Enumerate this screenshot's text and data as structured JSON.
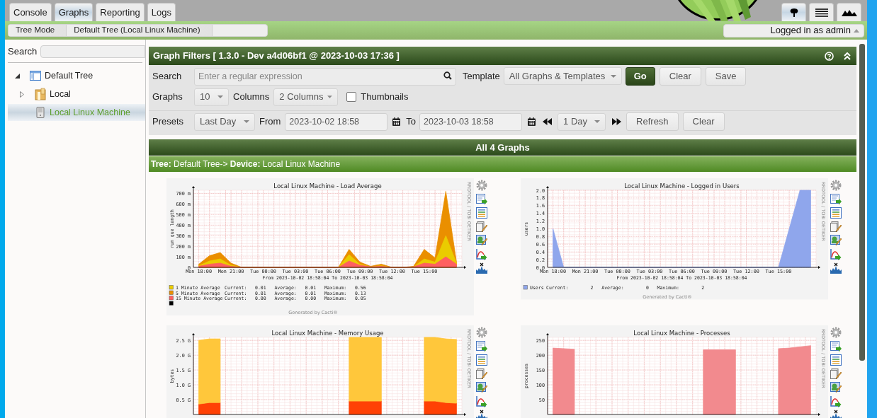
{
  "tabs": [
    {
      "label": "Console",
      "selected": false
    },
    {
      "label": "Graphs",
      "selected": true
    },
    {
      "label": "Reporting",
      "selected": false
    },
    {
      "label": "Logs",
      "selected": false
    }
  ],
  "view_buttons": [
    {
      "kind": "tree",
      "selected": true
    },
    {
      "kind": "list",
      "selected": false
    },
    {
      "kind": "preview",
      "selected": false
    }
  ],
  "breadcrumbs": [
    "Tree Mode",
    "Default Tree (Local Linux Machine)"
  ],
  "user_menu": {
    "label": "Logged in as admin"
  },
  "sidebar": {
    "search_label": "Search",
    "tree": [
      {
        "label": "Default Tree",
        "kind": "tree",
        "expanded": true,
        "selected": false,
        "children": [
          {
            "label": "Local",
            "kind": "site",
            "expanded": false,
            "selected": false
          },
          {
            "label": "Local Linux Machine",
            "kind": "device",
            "selected": true
          }
        ]
      }
    ]
  },
  "filters": {
    "title": "Graph Filters [ 1.3.0 - Dev a4d06bf1 @ 2023-10-03 17:36 ]",
    "search": {
      "label": "Search",
      "placeholder": "Enter a regular expression"
    },
    "template": {
      "label": "Template",
      "value": "All Graphs & Templates"
    },
    "buttons": [
      {
        "label": "Go",
        "kind": "primary"
      },
      {
        "label": "Clear",
        "kind": "normal"
      },
      {
        "label": "Save",
        "kind": "normal"
      }
    ],
    "graphs": {
      "label": "Graphs",
      "value": "10"
    },
    "columns": {
      "label": "Columns",
      "value": "2 Columns"
    },
    "thumbnails": {
      "label": "Thumbnails",
      "checked": false
    },
    "presets": {
      "label": "Presets",
      "value": "Last Day"
    },
    "from": {
      "label": "From",
      "value": "2023-10-02 18:58"
    },
    "to": {
      "label": "To",
      "value": "2023-10-03 18:58"
    },
    "timespan": {
      "value": "1 Day"
    },
    "time_buttons": [
      "Refresh",
      "Clear"
    ]
  },
  "graphs_header": "All 4 Graphs",
  "tree_path": "**Tree:** Default Tree-> **Device:** Local Linux Machine",
  "graphs": [
    {
      "side_text": "RRDTOOL / TOBI OETIKER",
      "range": "From 2023-10-02 18:58:04 To 2023-10-03 18:58:04",
      "credit": "Generated by Cacti®",
      "legend": [
        {
          "color": "#EACC00",
          "label": "1 Minute Average",
          "stats": "Current:   0.01   Average:   0.01   Maximum:   0.56"
        },
        {
          "color": "#EA8F00",
          "label": "5 Minute Average",
          "stats": "Current:   0.01   Average:   0.01   Maximum:   0.13"
        },
        {
          "color": "#FF6060",
          "label": "15 Minute Average",
          "stats": "Current:   0.00   Average:   0.00   Maximum:   0.05"
        },
        {
          "color": "#000000"
        }
      ],
      "chart_data": {
        "type": "area",
        "grid": true,
        "title": "Local Linux Machine - Load Average",
        "ylabel": "run que length",
        "categories": [
          "Mon 18:00",
          null,
          null,
          "Mon 21:00",
          null,
          null,
          "Tue 00:00",
          null,
          null,
          "Tue 03:00",
          null,
          null,
          "Tue 06:00",
          null,
          null,
          "Tue 09:00",
          null,
          null,
          "Tue 12:00",
          null,
          null,
          "Tue 15:00",
          null,
          null,
          null
        ],
        "series": [
          {
            "color": "#EA8F00",
            "values": [
              30,
              110,
              140,
              40,
              0,
              0,
              0,
              0,
              0,
              0,
              0,
              0,
              0,
              0,
              170,
              50,
              10,
              30,
              0,
              0,
              10,
              170,
              90,
              720,
              50
            ]
          },
          {
            "color": "#EACC00",
            "values": [
              15,
              60,
              80,
              20,
              0,
              0,
              0,
              0,
              0,
              0,
              0,
              0,
              0,
              0,
              120,
              30,
              5,
              15,
              0,
              0,
              5,
              80,
              50,
              300,
              40
            ]
          },
          {
            "color": "#FF6060",
            "values": [
              10,
              30,
              40,
              10,
              0,
              0,
              0,
              0,
              0,
              0,
              0,
              0,
              0,
              0,
              60,
              20,
              5,
              10,
              0,
              0,
              5,
              40,
              30,
              100,
              30
            ]
          }
        ],
        "ylim": [
          0,
          730
        ],
        "yticks": [
          {
            "value": 0,
            "label": "0"
          },
          {
            "value": 100,
            "label": "100 m"
          },
          {
            "value": 200,
            "label": "200 m"
          },
          {
            "value": 300,
            "label": "300 m"
          },
          {
            "value": 400,
            "label": "400 m"
          },
          {
            "value": 500,
            "label": "500 m"
          },
          {
            "value": 600,
            "label": "600 m"
          },
          {
            "value": 700,
            "label": "700 m"
          }
        ]
      }
    },
    {
      "side_text": "RRDTOOL / TOBI OETIKER",
      "range": "From 2023-10-02 18:58:04 To 2023-10-03 18:58:04",
      "credit": "Generated by Cacti®",
      "legend": [
        {
          "color": "#8FA6EC",
          "label": "Users",
          "stats": "Current:        2   Average:        0   Maximum:        2"
        }
      ],
      "chart_data": {
        "type": "area",
        "grid": true,
        "title": "Local Linux Machine - Logged in Users",
        "ylabel": "users",
        "categories": [
          "Mon 18:00",
          null,
          null,
          "Mon 21:00",
          null,
          null,
          "Tue 00:00",
          null,
          null,
          "Tue 03:00",
          null,
          null,
          "Tue 06:00",
          null,
          null,
          "Tue 09:00",
          null,
          null,
          "Tue 12:00",
          null,
          null,
          "Tue 15:00",
          null,
          null,
          null
        ],
        "series": [
          {
            "color": "#8FA6EC",
            "values": [
              1,
              0,
              0,
              0,
              0,
              0,
              0,
              0,
              0,
              0,
              0,
              0,
              0,
              0,
              0,
              0,
              0,
              0,
              0,
              0,
              0,
              0,
              1,
              2,
              2
            ]
          }
        ],
        "ylim": [
          0,
          2
        ],
        "yticks": [
          {
            "value": 0,
            "label": "0.0"
          },
          {
            "value": 0.2,
            "label": "0.2"
          },
          {
            "value": 0.4,
            "label": "0.4"
          },
          {
            "value": 0.6,
            "label": "0.6"
          },
          {
            "value": 0.8,
            "label": "0.8"
          },
          {
            "value": 1,
            "label": "1.0"
          },
          {
            "value": 1.2,
            "label": "1.2"
          },
          {
            "value": 1.4,
            "label": "1.4"
          },
          {
            "value": 1.6,
            "label": "1.6"
          },
          {
            "value": 1.8,
            "label": "1.8"
          },
          {
            "value": 2,
            "label": "2.0"
          }
        ]
      }
    },
    {
      "side_text": "RRDTOOL / TOBI OETIKER",
      "chart_data": {
        "type": "area",
        "grid": true,
        "title": "Local Linux Machine - Memory Usage",
        "ylabel": "bytes",
        "stacked": true,
        "categories": [
          null,
          null,
          null,
          null,
          null,
          null,
          null,
          null,
          null,
          null,
          null,
          null,
          null,
          null,
          null,
          null,
          null,
          null,
          null,
          null,
          null,
          null,
          null,
          null,
          null
        ],
        "series": [
          {
            "color": "#FF4105",
            "values": [
              0.35,
              0.4,
              0.4,
              null,
              null,
              null,
              null,
              null,
              null,
              null,
              null,
              null,
              null,
              null,
              0.45,
              0.45,
              0.45,
              0.45,
              null,
              null,
              null,
              0.45,
              0.45,
              0.4,
              0.38
            ]
          },
          {
            "color": "#FFC73B",
            "values": [
              2.15,
              2.15,
              2.15,
              null,
              null,
              null,
              null,
              null,
              null,
              null,
              null,
              null,
              null,
              null,
              2.15,
              2.15,
              2.15,
              2.15,
              null,
              null,
              null,
              2.15,
              2.15,
              2.15,
              2.15
            ]
          }
        ],
        "ylim": [
          0,
          2.6
        ],
        "yticks": [
          {
            "value": 0.5,
            "label": "0.5 G"
          },
          {
            "value": 1,
            "label": "1.0 G"
          },
          {
            "value": 1.5,
            "label": "1.5 G"
          },
          {
            "value": 2,
            "label": "2.0 G"
          },
          {
            "value": 2.5,
            "label": "2.5 G"
          }
        ]
      }
    },
    {
      "side_text": "RRDTOOL / TOBI OETIKER",
      "chart_data": {
        "type": "area",
        "grid": true,
        "title": "Local Linux Machine - Processes",
        "ylabel": "processes",
        "categories": [
          null,
          null,
          null,
          null,
          null,
          null,
          null,
          null,
          null,
          null,
          null,
          null,
          null,
          null,
          null,
          null,
          null,
          null,
          null,
          null,
          null,
          null,
          null,
          null,
          null
        ],
        "series": [
          {
            "color": "#F28A8E",
            "values": [
              224,
              222,
              220,
              null,
              null,
              null,
              null,
              null,
              null,
              null,
              null,
              null,
              null,
              null,
              218,
              218,
              218,
              218,
              null,
              null,
              null,
              222,
              224,
              228,
              232
            ]
          }
        ],
        "ylim": [
          0,
          260
        ],
        "yticks": [
          {
            "value": 50,
            "label": "50"
          },
          {
            "value": 100,
            "label": "100"
          },
          {
            "value": 150,
            "label": "150"
          },
          {
            "value": 200,
            "label": "200"
          },
          {
            "value": 250,
            "label": "250"
          }
        ]
      }
    }
  ]
}
